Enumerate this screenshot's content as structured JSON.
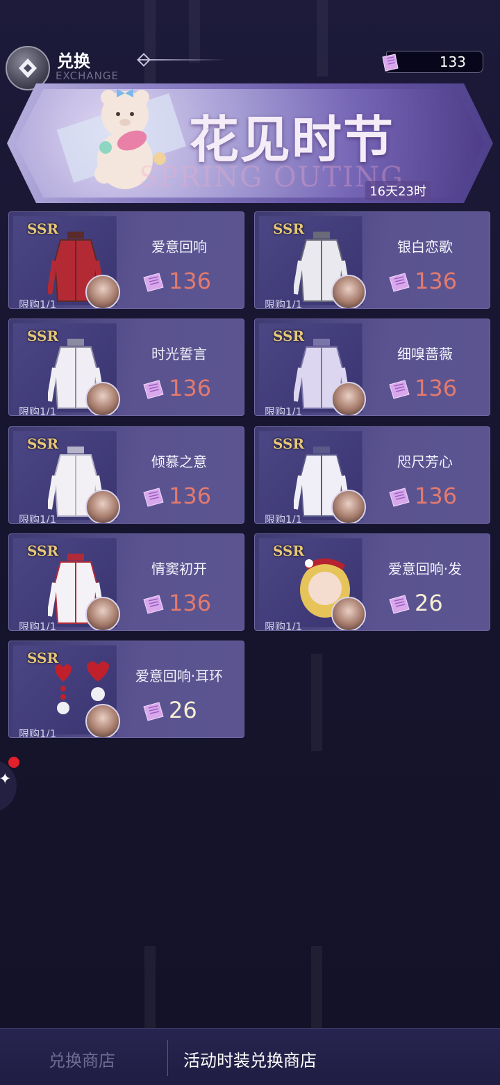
{
  "header": {
    "title": "兑换",
    "subtitle": "EXCHANGE",
    "currency_value": "133"
  },
  "banner": {
    "title": "花见时节",
    "subtitle": "SPRING OUTING",
    "timer": "16天23时"
  },
  "items": [
    {
      "rarity": "SSR",
      "name": "爱意回响",
      "price": "136",
      "limit": "限购1/1"
    },
    {
      "rarity": "SSR",
      "name": "银白恋歌",
      "price": "136",
      "limit": "限购1/1"
    },
    {
      "rarity": "SSR",
      "name": "时光誓言",
      "price": "136",
      "limit": "限购1/1"
    },
    {
      "rarity": "SSR",
      "name": "细嗅蔷薇",
      "price": "136",
      "limit": "限购1/1"
    },
    {
      "rarity": "SSR",
      "name": "倾慕之意",
      "price": "136",
      "limit": "限购1/1"
    },
    {
      "rarity": "SSR",
      "name": "咫尺芳心",
      "price": "136",
      "limit": "限购1/1"
    },
    {
      "rarity": "SSR",
      "name": "情窦初开",
      "price": "136",
      "limit": "限购1/1"
    },
    {
      "rarity": "SSR",
      "name": "爱意回响·发",
      "price": "26",
      "limit": "限购1/1"
    },
    {
      "rarity": "SSR",
      "name": "爱意回响·耳环",
      "price": "26",
      "limit": "限购1/1"
    }
  ],
  "tabs": {
    "exchange_shop": "兑换商店",
    "event_outfit_shop": "活动时装兑换商店"
  },
  "colors": {
    "price_high": "#e37a6e",
    "price_low": "#f7efd4",
    "rarity": "#e7c77a",
    "badge": "#e0202a"
  }
}
